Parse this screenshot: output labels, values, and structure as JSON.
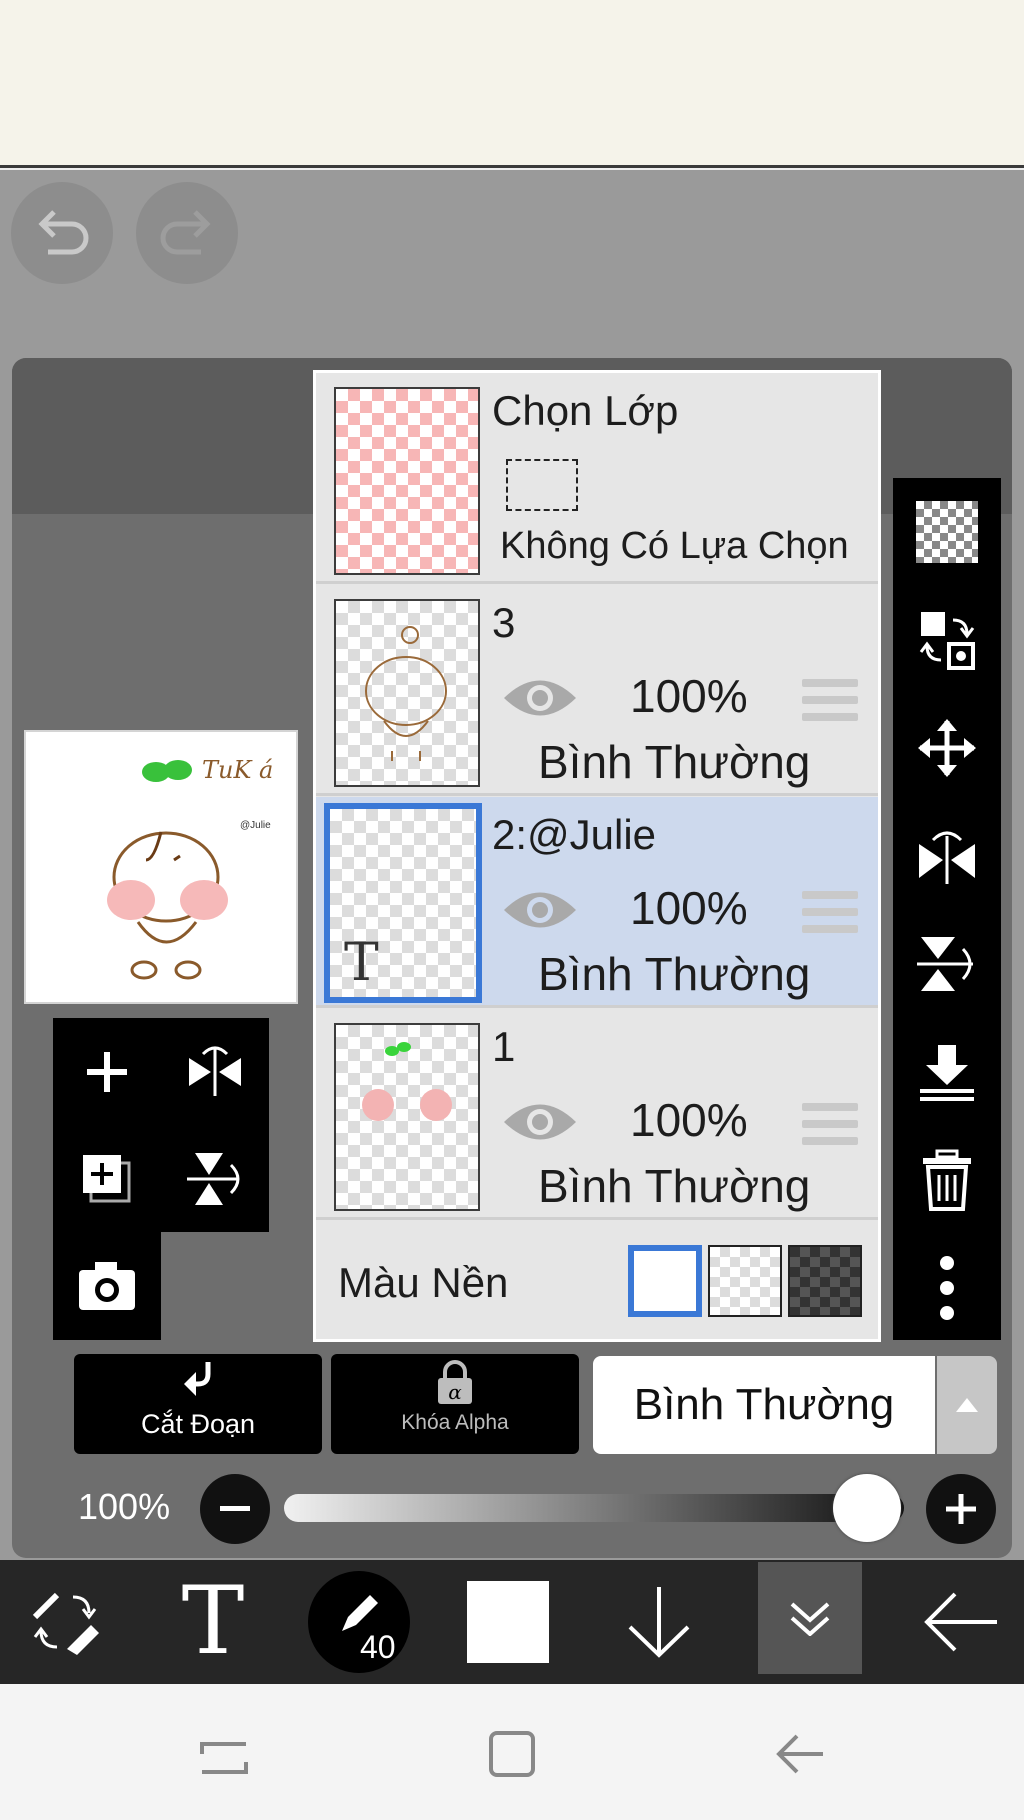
{
  "layers_panel": {
    "selection_layer": {
      "title": "Chọn Lớp",
      "status": "Không Có Lựa Chọn"
    },
    "layers": [
      {
        "name": "3",
        "opacity": "100%",
        "blend": "Bình Thường",
        "selected": false
      },
      {
        "name": "2:@Julie",
        "opacity": "100%",
        "blend": "Bình Thường",
        "selected": true
      },
      {
        "name": "1",
        "opacity": "100%",
        "blend": "Bình Thường",
        "selected": false
      }
    ],
    "background": {
      "label": "Màu Nền"
    }
  },
  "preview_text": {
    "title": "TuK á",
    "side": "@Julie"
  },
  "controls": {
    "clip_label": "Cắt Đoạn",
    "alpha_lock_label": "Khóa Alpha",
    "blend_mode_value": "Bình Thường",
    "opacity_label": "100%",
    "opacity_value": 1.0,
    "brush_size": "40"
  },
  "icons": {
    "undo": "undo-icon",
    "redo": "redo-icon",
    "left_tools": [
      "add-layer-icon",
      "flip-horizontal-icon",
      "copy-layer-icon",
      "flip-vertical-icon",
      "camera-icon"
    ],
    "right_tools": [
      "checkerboard-icon",
      "swap-transform-icon",
      "move-icon",
      "flip-horizontal-icon",
      "flip-vertical-icon",
      "merge-down-icon",
      "trash-icon",
      "more-icon"
    ],
    "bottom": [
      "transform-tool-icon",
      "text-tool-icon",
      "brush-tool-icon",
      "color-swatch-icon",
      "arrow-down-icon",
      "layers-collapse-icon",
      "back-arrow-icon"
    ]
  },
  "colors": {
    "selected_row": "#cdd9ed",
    "selection_border": "#3a78d6",
    "toolbar": "#000000"
  }
}
